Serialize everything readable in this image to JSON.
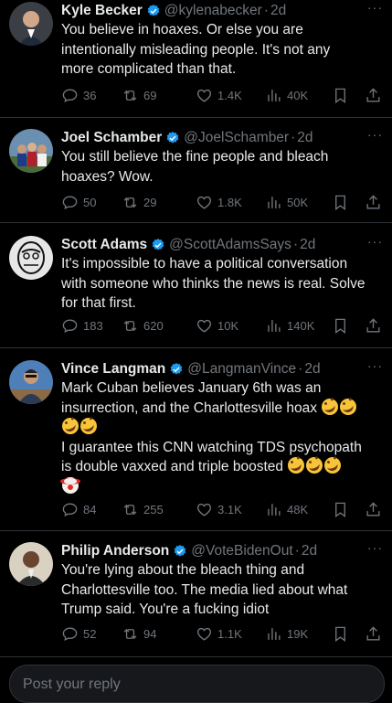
{
  "tweets": [
    {
      "name": "Kyle Becker",
      "handle": "@kylenabecker",
      "time": "2d",
      "lines": [
        "You believe in hoaxes. Or else you are",
        "intentionally misleading people. It's not any",
        "more complicated than that."
      ],
      "replies": "36",
      "retweets": "69",
      "likes": "1.4K",
      "views": "40K"
    },
    {
      "name": "Joel Schamber",
      "handle": "@JoelSchamber",
      "time": "2d",
      "lines": [
        "You still believe the fine people and bleach",
        "hoaxes? Wow."
      ],
      "replies": "50",
      "retweets": "29",
      "likes": "1.8K",
      "views": "50K"
    },
    {
      "name": "Scott Adams",
      "handle": "@ScottAdamsSays",
      "time": "2d",
      "lines": [
        "It's impossible to have a political conversation",
        "with someone who thinks the news is real. Solve",
        "for that first."
      ],
      "replies": "183",
      "retweets": "620",
      "likes": "10K",
      "views": "140K"
    },
    {
      "name": "Vince Langman",
      "handle": "@LangmanVince",
      "time": "2d",
      "lines": [
        "Mark Cuban believes January 6th was an",
        "insurrection, and the Charlottesville hoax",
        "",
        "I guarantee this CNN watching TDS psychopath",
        "is double vaxxed and triple boosted"
      ],
      "replies": "84",
      "retweets": "255",
      "likes": "3.1K",
      "views": "48K"
    },
    {
      "name": "Philip Anderson",
      "handle": "@VoteBidenOut",
      "time": "2d",
      "lines": [
        "You're lying about the bleach thing and",
        "Charlottesville too. The media lied about what",
        "Trump said. You're a fucking idiot"
      ],
      "replies": "52",
      "retweets": "94",
      "likes": "1.1K",
      "views": "19K"
    }
  ],
  "reply_box": {
    "placeholder": "Post your reply"
  },
  "separator": "·",
  "more_glyph": "···",
  "colors": {
    "background": "#000000",
    "text": "#e7e9ea",
    "muted": "#71767b",
    "verified": "#1d9bf0",
    "divider": "#2f3336"
  }
}
